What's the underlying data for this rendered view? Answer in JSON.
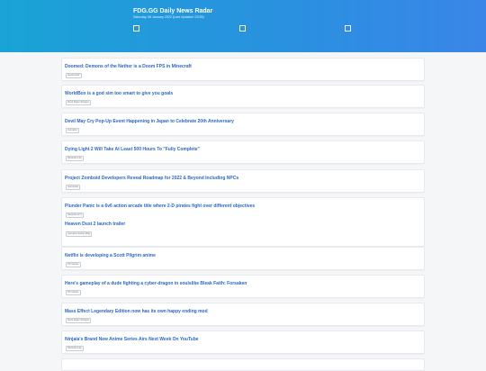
{
  "header": {
    "title": "FDG.GG Daily News Radar",
    "subtitle": "Saturday, 08 January 2022 (Last Updated: 23:55)",
    "accent": "#2a90e0"
  },
  "articles": [
    {
      "title": "Doomed: Demons of the Nether is a Doom FPS in Minecraft",
      "tag": "Destructoid"
    },
    {
      "title": "WorldBox is a god sim too smart to give you goals",
      "tag": "Rock Paper Shotgun"
    },
    {
      "title": "Devil May Cry Pop-Up Event Happening in Japan to Celebrate 20th Anniversary",
      "tag": "Gematsu"
    },
    {
      "title": "Dying Light 2 Will Take At Least 500 Hours To \"Fully Complete\"",
      "tag": "Nintendo Life"
    },
    {
      "title": "Project Zomboid Developers Reveal Roadmap for 2022 & Beyond Including NPCs",
      "tag": "Gameplay"
    },
    {
      "title": "Plunder Panic is a 6v6 action arcade title where 2-D pirates fight over different objectives",
      "tag": "Nintendo GTI"
    },
    {
      "title": "Heaven Dust 2 launch trailer",
      "tag": "Gematsu Switch Mag"
    },
    {
      "title": "Netflix is developing a Scott Pilgrim anime",
      "tag": "PC Gamer"
    },
    {
      "title": "Here's gameplay of a dude fighting a cyber-dragon in soulslike Bleak Faith: Forsaken",
      "tag": "PC Gamer"
    },
    {
      "title": "Mass Effect Legendary Edition now has its own happy ending mod",
      "tag": "Rock Paper Shotgun"
    },
    {
      "title": "Ninjala's Brand New Anime Series Airs Next Week On YouTube",
      "tag": "Nintendo Life"
    }
  ]
}
